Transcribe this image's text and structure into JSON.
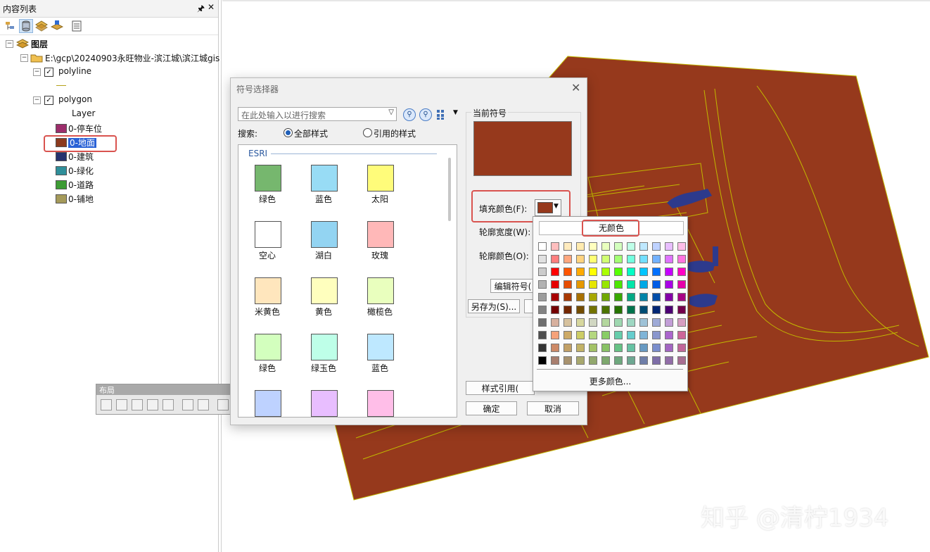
{
  "toc": {
    "title": "内容列表",
    "pin_icon": "pin-icon",
    "close_icon": "close-icon",
    "root": "图层",
    "path": "E:\\gcp\\20240903永旺物业-滨江城\\滨江城gis",
    "layers": [
      {
        "name": "polyline",
        "checked": true
      },
      {
        "name": "polygon",
        "checked": true,
        "field": "Layer",
        "classes": [
          {
            "label": "0-停车位",
            "color": "#9c2d6b"
          },
          {
            "label": "0-地面",
            "color": "#8b3a1e"
          },
          {
            "label": "0-建筑",
            "color": "#26326e"
          },
          {
            "label": "0-绿化",
            "color": "#2f8f9a"
          },
          {
            "label": "0-道路",
            "color": "#3e9c35"
          },
          {
            "label": "0-铺地",
            "color": "#a59a5a"
          }
        ]
      }
    ]
  },
  "layout_toolbar": {
    "title": "布局"
  },
  "dialog": {
    "title": "符号选择器",
    "search_placeholder": "在此处输入以进行搜索",
    "search_label": "搜索:",
    "radio_all": "全部样式",
    "radio_ref": "引用的样式",
    "group_label": "ESRI",
    "symbols": [
      {
        "label": "绿色",
        "color": "#76b76e"
      },
      {
        "label": "蓝色",
        "color": "#98dcf5"
      },
      {
        "label": "太阳",
        "color": "#fffc7a"
      },
      {
        "label": "空心",
        "color": "#ffffff"
      },
      {
        "label": "湖白",
        "color": "#93d4f2"
      },
      {
        "label": "玫瑰",
        "color": "#ffb8b8"
      },
      {
        "label": "米黄色",
        "color": "#ffe6bd"
      },
      {
        "label": "黄色",
        "color": "#ffffbe"
      },
      {
        "label": "橄榄色",
        "color": "#e9ffbe"
      },
      {
        "label": "绿色",
        "color": "#d3ffbe"
      },
      {
        "label": "绿玉色",
        "color": "#beffe8"
      },
      {
        "label": "蓝色",
        "color": "#bee8ff"
      },
      {
        "label": "",
        "color": "#bed2ff"
      },
      {
        "label": "",
        "color": "#e8beff"
      },
      {
        "label": "",
        "color": "#ffbee8"
      }
    ],
    "current_symbol_label": "当前符号",
    "current_color": "#96391c",
    "fill_color_label": "填充颜色(F):",
    "outline_width_label": "轮廓宽度(W):",
    "outline_color_label": "轮廓颜色(O):",
    "edit_symbol_label": "编辑符号(",
    "save_as_label": "另存为(S)...",
    "style_ref_label": "样式引用(",
    "ok_label": "确定",
    "cancel_label": "取消"
  },
  "color_popup": {
    "no_color_label": "无颜色",
    "more_colors_label": "更多颜色...",
    "palette": [
      [
        "#ffffff",
        "#ffbebe",
        "#ffebbe",
        "#ffebaf",
        "#ffffbe",
        "#e9ffbe",
        "#d3ffbe",
        "#beffe8",
        "#bee8ff",
        "#bed2ff",
        "#e8beff",
        "#ffbee8"
      ],
      [
        "#e1e1e1",
        "#ff7f7f",
        "#ffa77f",
        "#ffd37f",
        "#ffff73",
        "#d1ff73",
        "#a3ff73",
        "#73ffdf",
        "#73dfff",
        "#73b2ff",
        "#df73ff",
        "#ff73df"
      ],
      [
        "#cccccc",
        "#ff0000",
        "#ff5500",
        "#ffaa00",
        "#ffff00",
        "#aaff00",
        "#55ff00",
        "#00ffc5",
        "#00c5ff",
        "#0070ff",
        "#c500ff",
        "#ff00c5"
      ],
      [
        "#b2b2b2",
        "#e60000",
        "#e64c00",
        "#e69800",
        "#e6e600",
        "#98e600",
        "#4ce600",
        "#00e6a9",
        "#00a9e6",
        "#005ce6",
        "#a900e6",
        "#e600a9"
      ],
      [
        "#9c9c9c",
        "#a80000",
        "#a83800",
        "#a87000",
        "#a8a800",
        "#70a800",
        "#38a800",
        "#00a884",
        "#0084a8",
        "#004da8",
        "#8400a8",
        "#a80084"
      ],
      [
        "#828282",
        "#730000",
        "#732600",
        "#734c00",
        "#737300",
        "#4c7300",
        "#267300",
        "#00734c",
        "#004c73",
        "#002673",
        "#4c0073",
        "#73004c"
      ],
      [
        "#6e6e6e",
        "#d7b09e",
        "#d7c29e",
        "#d7d79e",
        "#d1d7c2",
        "#b4d79e",
        "#9ed7b0",
        "#9ed7c2",
        "#9ec2d7",
        "#9eaad7",
        "#c29ed7",
        "#d79ec2"
      ],
      [
        "#4e4e4e",
        "#f5a27a",
        "#cdaa66",
        "#cdcd66",
        "#b4d77f",
        "#89cd66",
        "#66cdab",
        "#66cdcd",
        "#7fb4d7",
        "#8996cd",
        "#ab66cd",
        "#cd6699"
      ],
      [
        "#343434",
        "#cd8966",
        "#c2a066",
        "#c2b266",
        "#a3c266",
        "#89c266",
        "#66c285",
        "#66c2a3",
        "#6699c2",
        "#7a8ecd",
        "#a366c2",
        "#c26699"
      ],
      [
        "#000000",
        "#a87e6e",
        "#a8926e",
        "#a8a86e",
        "#92a86e",
        "#7ea86e",
        "#6ea87e",
        "#6ea892",
        "#6e7ea8",
        "#7e6ea8",
        "#926ea8",
        "#a86e92"
      ]
    ]
  },
  "map": {
    "fill_color": "#96391c",
    "line_color": "#c2b800",
    "building_color": "#2d3a8c"
  },
  "watermark": "知乎 @清柠1934"
}
